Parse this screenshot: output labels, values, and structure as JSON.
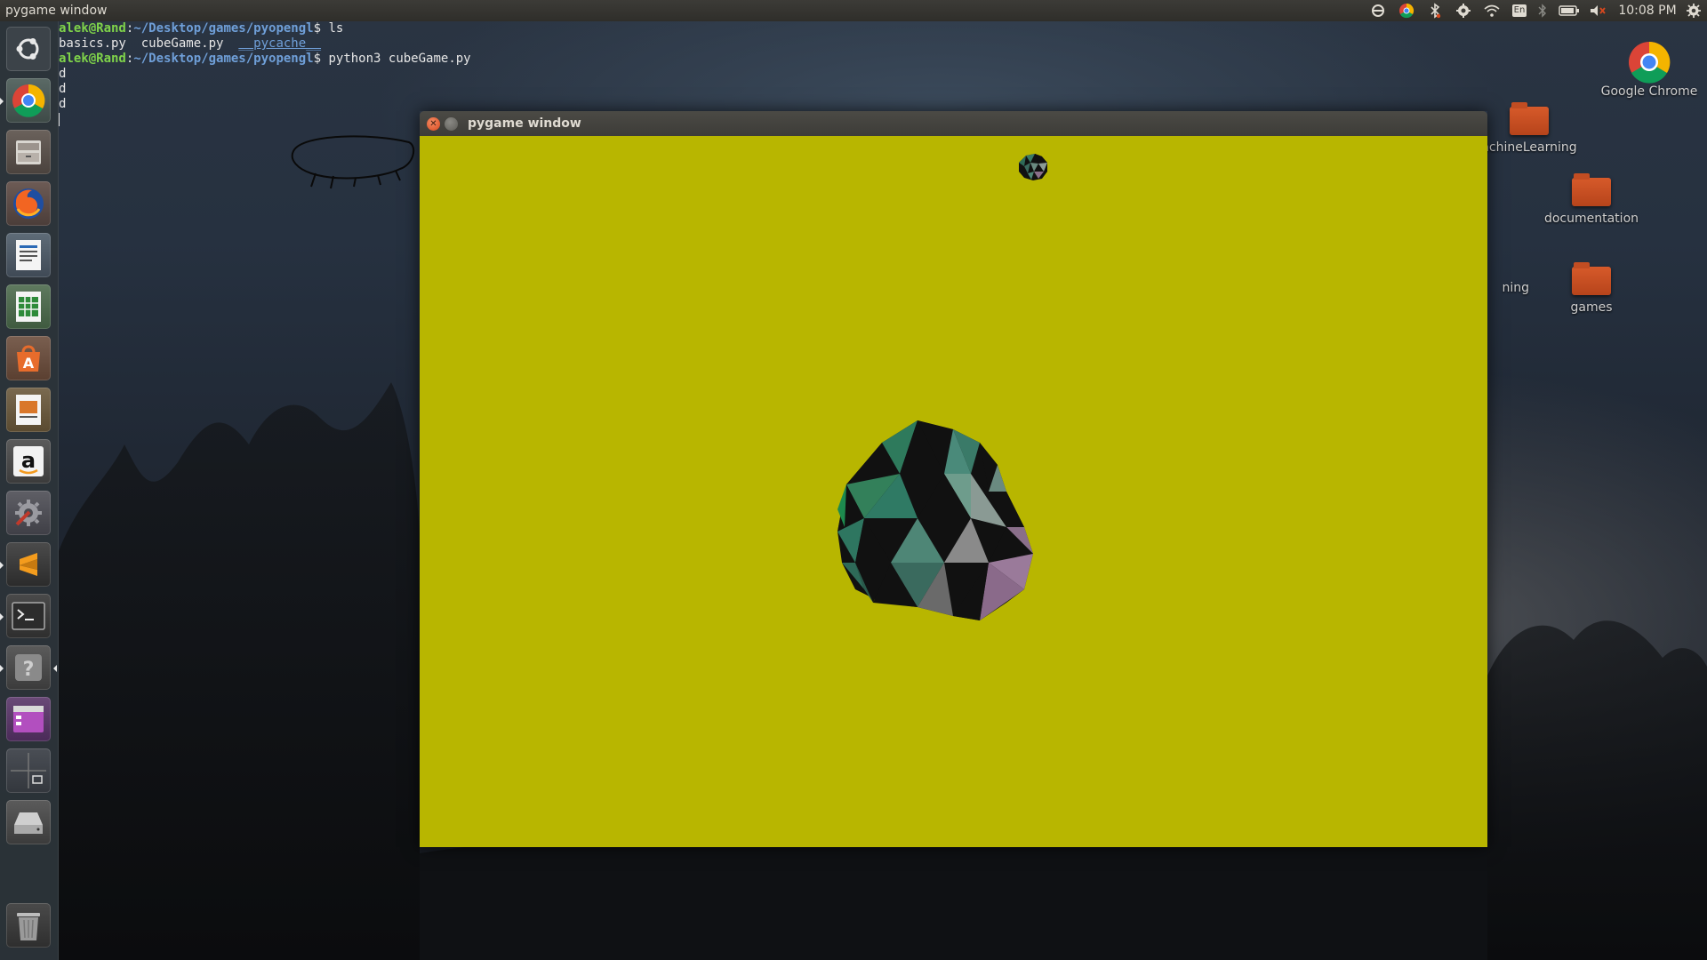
{
  "top_panel": {
    "title": "pygame window",
    "clock": "10:08 PM",
    "keyboard_layout": "En",
    "tray_icons": [
      "sync-icon",
      "chrome-icon",
      "bluetooth-icon",
      "settings-icon",
      "wifi-icon",
      "keyboard-icon",
      "bluetooth-icon",
      "battery-icon",
      "volume-icon",
      "clock",
      "power-icon"
    ]
  },
  "launcher": {
    "items": [
      {
        "name": "dash-home",
        "icon": "ubuntu-logo-icon"
      },
      {
        "name": "google-chrome",
        "icon": "chrome-icon"
      },
      {
        "name": "files",
        "icon": "file-cabinet-icon"
      },
      {
        "name": "firefox",
        "icon": "firefox-icon"
      },
      {
        "name": "libreoffice-writer",
        "icon": "writer-icon"
      },
      {
        "name": "libreoffice-calc",
        "icon": "calc-icon"
      },
      {
        "name": "ubuntu-software",
        "icon": "software-center-icon"
      },
      {
        "name": "libreoffice-impress",
        "icon": "impress-icon"
      },
      {
        "name": "amazon",
        "icon": "amazon-icon"
      },
      {
        "name": "system-settings",
        "icon": "settings-tools-icon"
      },
      {
        "name": "sublime-text",
        "icon": "sublime-icon"
      },
      {
        "name": "terminal",
        "icon": "terminal-icon"
      },
      {
        "name": "help",
        "icon": "help-icon"
      },
      {
        "name": "app",
        "icon": "purple-window-icon"
      },
      {
        "name": "workspace-switcher",
        "icon": "workspace-icon"
      },
      {
        "name": "drive",
        "icon": "drive-icon"
      },
      {
        "name": "trash",
        "icon": "trash-icon"
      }
    ]
  },
  "terminal": {
    "line1": {
      "user": "alek@Rand",
      "path": "~/Desktop/games/pyopengl",
      "prompt": "$",
      "cmd": " ls"
    },
    "line2": {
      "files": [
        "basics.py",
        "cubeGame.py"
      ],
      "dir": "__pycache__"
    },
    "line3": {
      "user": "alek@Rand",
      "path": "~/Desktop/games/pyopengl",
      "prompt": "$",
      "cmd": " python3 cubeGame.py"
    },
    "output": [
      "d",
      "d",
      "d"
    ]
  },
  "desktop_icons": [
    {
      "label": "Google Chrome",
      "icon": "chrome-icon"
    },
    {
      "label": "achineLearning",
      "icon": "folder-icon"
    },
    {
      "label": "documentation",
      "icon": "folder-icon"
    },
    {
      "label": "ning",
      "icon": "folder-icon"
    },
    {
      "label": "games",
      "icon": "folder-icon"
    }
  ],
  "pygame_window": {
    "title": "pygame window",
    "canvas_color": "#b8b600",
    "objects": [
      "large-icosphere",
      "small-icosphere"
    ]
  },
  "colors": {
    "panel": "#3c3b37",
    "prompt_user": "#7fd34a",
    "prompt_path": "#6f9fd8",
    "folder": "#d75a2a",
    "close_button": "#d8481e"
  }
}
